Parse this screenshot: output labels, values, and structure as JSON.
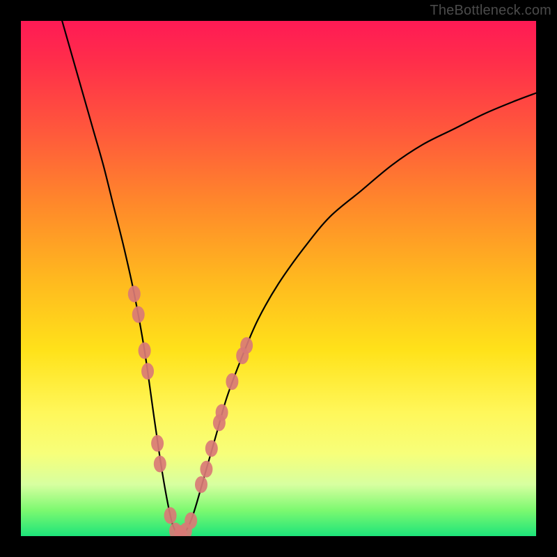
{
  "watermark": "TheBottleneck.com",
  "colors": {
    "background": "#000000",
    "curve": "#000000",
    "markers": "#d97a76",
    "gradient_top": "#ff1a55",
    "gradient_bottom": "#1de47a"
  },
  "chart_data": {
    "type": "line",
    "title": "",
    "xlabel": "",
    "ylabel": "",
    "xlim": [
      0,
      100
    ],
    "ylim": [
      0,
      100
    ],
    "series": [
      {
        "name": "bottleneck-curve",
        "x": [
          8,
          10,
          12,
          14,
          16,
          18,
          20,
          22,
          24,
          26,
          27.5,
          29,
          30,
          31,
          32,
          33,
          34,
          36,
          38,
          40,
          43,
          46,
          50,
          55,
          60,
          66,
          72,
          78,
          84,
          90,
          96,
          100
        ],
        "y": [
          100,
          93,
          86,
          79,
          72,
          64,
          56,
          47,
          36,
          22,
          12,
          4,
          1,
          0.5,
          1,
          3,
          6,
          13,
          20,
          27,
          35,
          42,
          49,
          56,
          62,
          67,
          72,
          76,
          79,
          82,
          84.5,
          86
        ]
      }
    ],
    "markers": {
      "name": "highlighted-points",
      "points": [
        {
          "x": 22.0,
          "y": 47
        },
        {
          "x": 22.8,
          "y": 43
        },
        {
          "x": 24.0,
          "y": 36
        },
        {
          "x": 24.6,
          "y": 32
        },
        {
          "x": 26.5,
          "y": 18
        },
        {
          "x": 27.0,
          "y": 14
        },
        {
          "x": 29.0,
          "y": 4
        },
        {
          "x": 30.0,
          "y": 1
        },
        {
          "x": 31.0,
          "y": 0.5
        },
        {
          "x": 32.0,
          "y": 1
        },
        {
          "x": 33.0,
          "y": 3
        },
        {
          "x": 35.0,
          "y": 10
        },
        {
          "x": 36.0,
          "y": 13
        },
        {
          "x": 37.0,
          "y": 17
        },
        {
          "x": 38.5,
          "y": 22
        },
        {
          "x": 39.0,
          "y": 24
        },
        {
          "x": 41.0,
          "y": 30
        },
        {
          "x": 43.0,
          "y": 35
        },
        {
          "x": 43.8,
          "y": 37
        }
      ]
    }
  }
}
